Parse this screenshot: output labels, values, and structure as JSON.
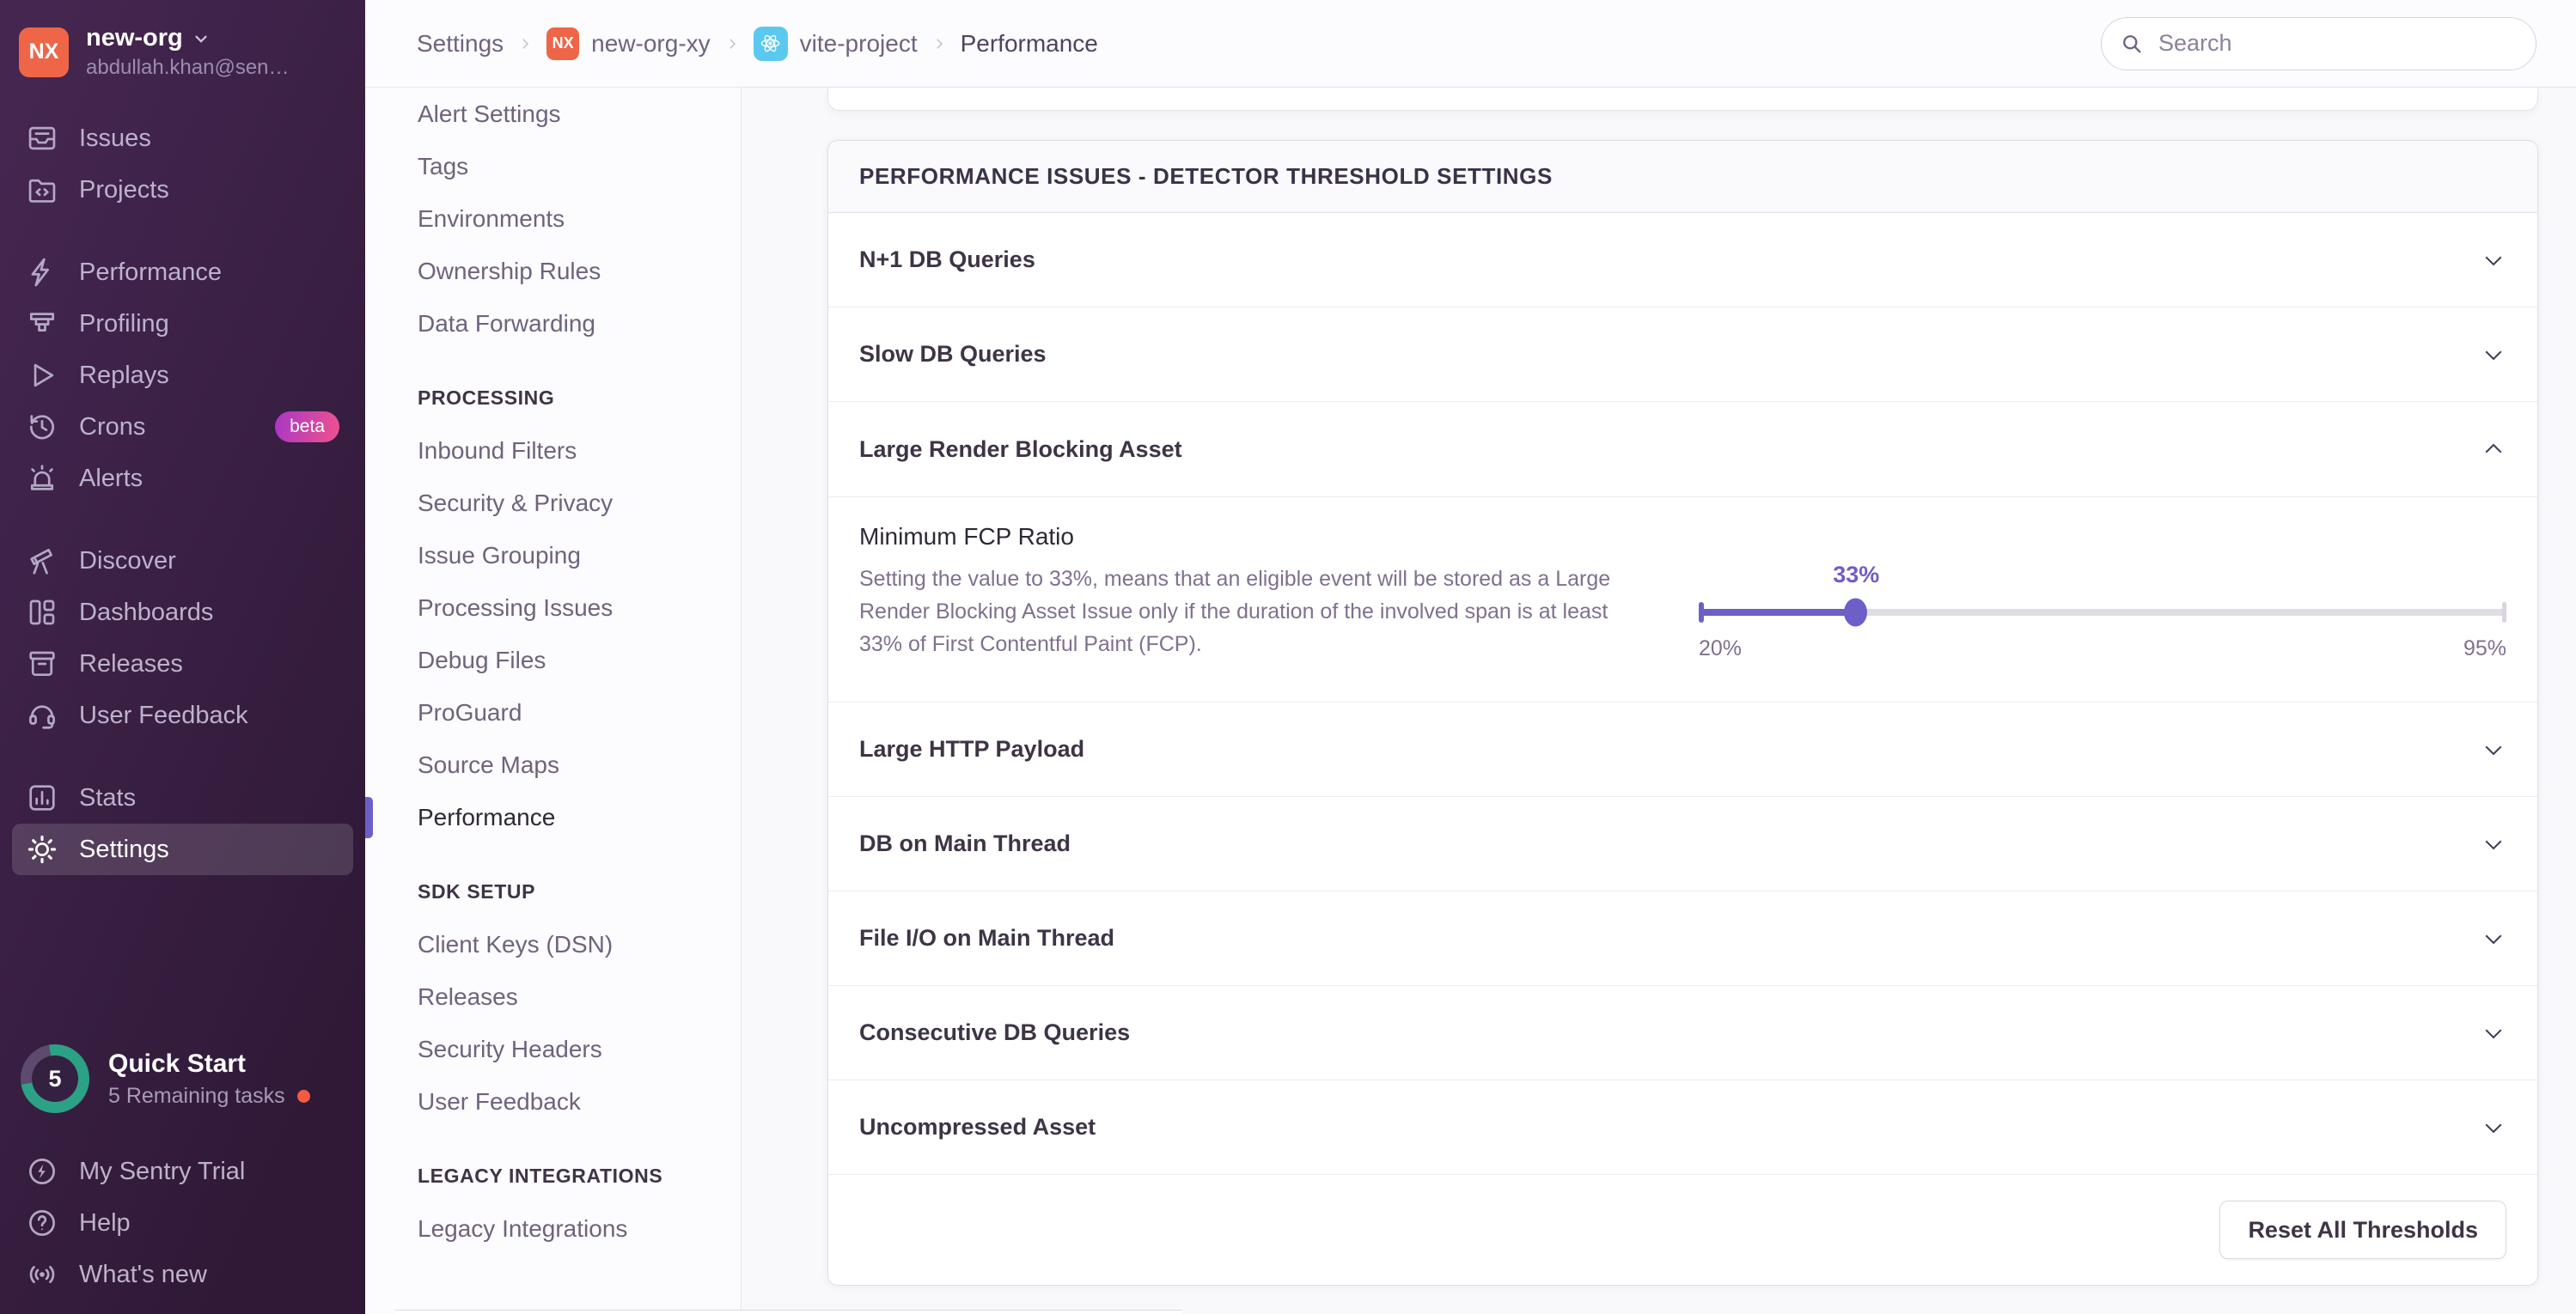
{
  "colors": {
    "accent_purple": "#6C5FC7",
    "org_avatar": "#EE6647",
    "project_icon_bg": "#5BC8EF",
    "quickstart_green": "#2BA185",
    "notification_dot": "#F25B40",
    "sidebar_gradient": [
      "#2F1937",
      "#452650"
    ]
  },
  "sidebar": {
    "org": {
      "initials": "NX",
      "name": "new-org",
      "email": "abdullah.khan@sen…"
    },
    "sections": [
      {
        "items": [
          {
            "label": "Issues",
            "icon": "issues-icon"
          },
          {
            "label": "Projects",
            "icon": "projects-icon"
          }
        ]
      },
      {
        "items": [
          {
            "label": "Performance",
            "icon": "performance-icon"
          },
          {
            "label": "Profiling",
            "icon": "profiling-icon"
          },
          {
            "label": "Replays",
            "icon": "replays-icon"
          },
          {
            "label": "Crons",
            "icon": "crons-icon",
            "badge": "beta"
          },
          {
            "label": "Alerts",
            "icon": "alerts-icon"
          }
        ]
      },
      {
        "items": [
          {
            "label": "Discover",
            "icon": "discover-icon"
          },
          {
            "label": "Dashboards",
            "icon": "dashboards-icon"
          },
          {
            "label": "Releases",
            "icon": "releases-icon"
          },
          {
            "label": "User Feedback",
            "icon": "user-feedback-icon"
          }
        ]
      },
      {
        "items": [
          {
            "label": "Stats",
            "icon": "stats-icon"
          },
          {
            "label": "Settings",
            "icon": "settings-icon",
            "active": true
          }
        ]
      }
    ],
    "quick_start": {
      "count": "5",
      "title": "Quick Start",
      "subtitle": "5 Remaining tasks"
    },
    "footer_items": [
      {
        "label": "My Sentry Trial",
        "icon": "trial-icon"
      },
      {
        "label": "Help",
        "icon": "help-icon"
      },
      {
        "label": "What's new",
        "icon": "whats-new-icon"
      }
    ]
  },
  "header": {
    "breadcrumb": [
      {
        "label": "Settings"
      },
      {
        "label": "new-org-xy",
        "avatar": "NX"
      },
      {
        "label": "vite-project",
        "icon": "react-project-icon"
      },
      {
        "label": "Performance",
        "current": true
      }
    ],
    "search_placeholder": "Search"
  },
  "settings_nav": {
    "items": [
      {
        "label": "Alert Settings"
      },
      {
        "label": "Tags"
      },
      {
        "label": "Environments"
      },
      {
        "label": "Ownership Rules"
      },
      {
        "label": "Data Forwarding"
      }
    ],
    "sections": [
      {
        "header": "PROCESSING",
        "items": [
          {
            "label": "Inbound Filters"
          },
          {
            "label": "Security & Privacy"
          },
          {
            "label": "Issue Grouping"
          },
          {
            "label": "Processing Issues"
          },
          {
            "label": "Debug Files"
          },
          {
            "label": "ProGuard"
          },
          {
            "label": "Source Maps"
          },
          {
            "label": "Performance",
            "active": true
          }
        ]
      },
      {
        "header": "SDK SETUP",
        "items": [
          {
            "label": "Client Keys (DSN)"
          },
          {
            "label": "Releases"
          },
          {
            "label": "Security Headers"
          },
          {
            "label": "User Feedback"
          }
        ]
      },
      {
        "header": "LEGACY INTEGRATIONS",
        "items": [
          {
            "label": "Legacy Integrations"
          }
        ]
      }
    ]
  },
  "main": {
    "panel_header": "PERFORMANCE ISSUES - DETECTOR THRESHOLD SETTINGS",
    "rows": [
      {
        "label": "N+1 DB Queries",
        "state": "collapsed"
      },
      {
        "label": "Slow DB Queries",
        "state": "collapsed"
      },
      {
        "label": "Large Render Blocking Asset",
        "state": "expanded"
      },
      {
        "label": "Large HTTP Payload",
        "state": "collapsed"
      },
      {
        "label": "DB on Main Thread",
        "state": "collapsed"
      },
      {
        "label": "File I/O on Main Thread",
        "state": "collapsed"
      },
      {
        "label": "Consecutive DB Queries",
        "state": "collapsed"
      },
      {
        "label": "Uncompressed Asset",
        "state": "collapsed"
      }
    ],
    "expanded_setting": {
      "title": "Minimum FCP Ratio",
      "description": "Setting the value to 33%, means that an eligible event will be stored as a Large Render Blocking Asset Issue only if the duration of the involved span is at least 33% of First Contentful Paint (FCP).",
      "slider": {
        "value": "33%",
        "min": "20%",
        "max": "95%",
        "fill_style": "width:19.5%"
      }
    },
    "reset_button": "Reset All Thresholds"
  }
}
